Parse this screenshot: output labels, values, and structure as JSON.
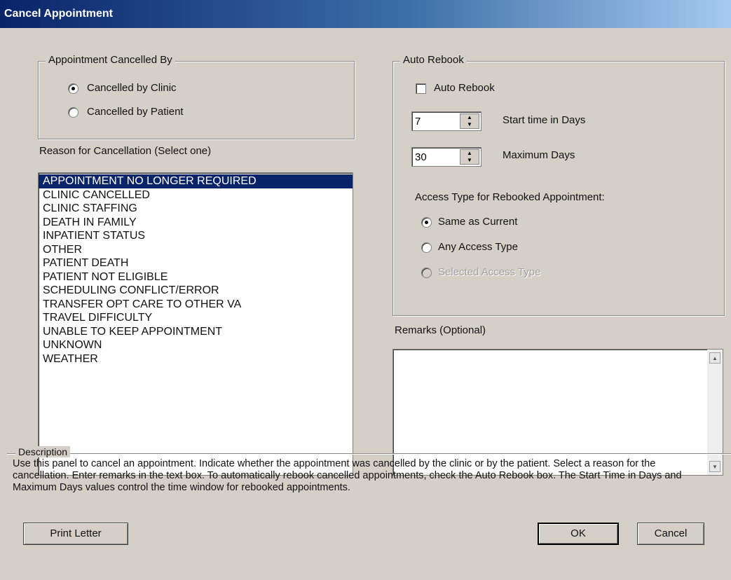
{
  "window": {
    "title": "Cancel Appointment"
  },
  "cancelled_by": {
    "legend": "Appointment Cancelled By",
    "options": [
      {
        "label": "Cancelled by Clinic",
        "selected": true
      },
      {
        "label": "Cancelled by Patient",
        "selected": false
      }
    ]
  },
  "reason": {
    "label": "Reason for Cancellation (Select one)",
    "selected_index": 0,
    "items": [
      "APPOINTMENT NO LONGER REQUIRED",
      "CLINIC CANCELLED",
      "CLINIC STAFFING",
      "DEATH IN FAMILY",
      "INPATIENT STATUS",
      "OTHER",
      "PATIENT DEATH",
      "PATIENT NOT ELIGIBLE",
      "SCHEDULING CONFLICT/ERROR",
      "TRANSFER OPT CARE TO OTHER VA",
      "TRAVEL DIFFICULTY",
      "UNABLE TO KEEP APPOINTMENT",
      "UNKNOWN",
      "WEATHER"
    ]
  },
  "auto_rebook": {
    "legend": "Auto Rebook",
    "checkbox_label": "Auto Rebook",
    "checked": false,
    "start_days": {
      "value": "7",
      "label": "Start time in Days"
    },
    "max_days": {
      "value": "30",
      "label": "Maximum Days"
    },
    "access_label": "Access Type for Rebooked Appointment:",
    "access_options": [
      {
        "label": "Same as Current",
        "selected": true,
        "enabled": true
      },
      {
        "label": "Any Access Type",
        "selected": false,
        "enabled": true
      },
      {
        "label": "Selected Access Type",
        "selected": false,
        "enabled": false
      }
    ]
  },
  "remarks": {
    "label": "Remarks (Optional)",
    "value": ""
  },
  "description": {
    "legend": "Description",
    "text": "Use this panel to cancel an appointment. Indicate whether the appointment was cancelled by the clinic or by the patient.  Select a reason for the cancellation.  Enter remarks in the text box.  To automatically rebook cancelled appointments, check the Auto Rebook box. The Start Time in Days and Maximum Days values control the time window for rebooked appointments."
  },
  "buttons": {
    "print_letter": "Print Letter",
    "ok": "OK",
    "cancel": "Cancel"
  },
  "colors": {
    "selection": "#0a246a",
    "title_start": "#0a246a",
    "dialog_bg": "#d4d0c8"
  }
}
